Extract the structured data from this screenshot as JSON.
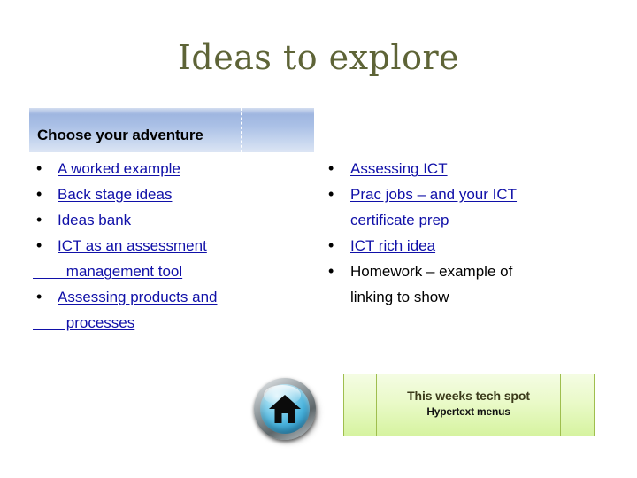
{
  "slide": {
    "title": "Ideas to explore",
    "title_color": "#5e6437"
  },
  "header_band": {
    "label": "Choose your adventure",
    "gradient_from": "#9fb6e0",
    "gradient_to": "#dce5f4"
  },
  "link_color": "#1010a8",
  "left_column": {
    "items": [
      {
        "text": "A worked example",
        "is_link": true,
        "continuation": null
      },
      {
        "text": "Back stage ideas",
        "is_link": true,
        "continuation": null
      },
      {
        "text": "Ideas bank",
        "is_link": true,
        "continuation": null
      },
      {
        "text": "ICT as an assessment",
        "is_link": true,
        "continuation": "        management tool"
      },
      {
        "text": "Assessing products and",
        "is_link": true,
        "continuation": "        processes"
      }
    ]
  },
  "right_column": {
    "items": [
      {
        "text": "Assessing ICT",
        "is_link": true,
        "continuation": null
      },
      {
        "text": "Prac jobs – and your ICT",
        "is_link": true,
        "continuation": "certificate prep"
      },
      {
        "text": "ICT rich idea",
        "is_link": true,
        "continuation": null
      },
      {
        "text": "Homework – example of",
        "is_link": false,
        "continuation": "linking to show"
      }
    ]
  },
  "home_button": {
    "icon": "home-icon",
    "face_color": "#49b3dd",
    "bezel_color": "#80898d"
  },
  "tech_spot": {
    "title": "This weeks tech spot",
    "subtitle": "Hypertext menus",
    "border_color": "#9fbe4e",
    "fill_color": "#eafac9"
  }
}
